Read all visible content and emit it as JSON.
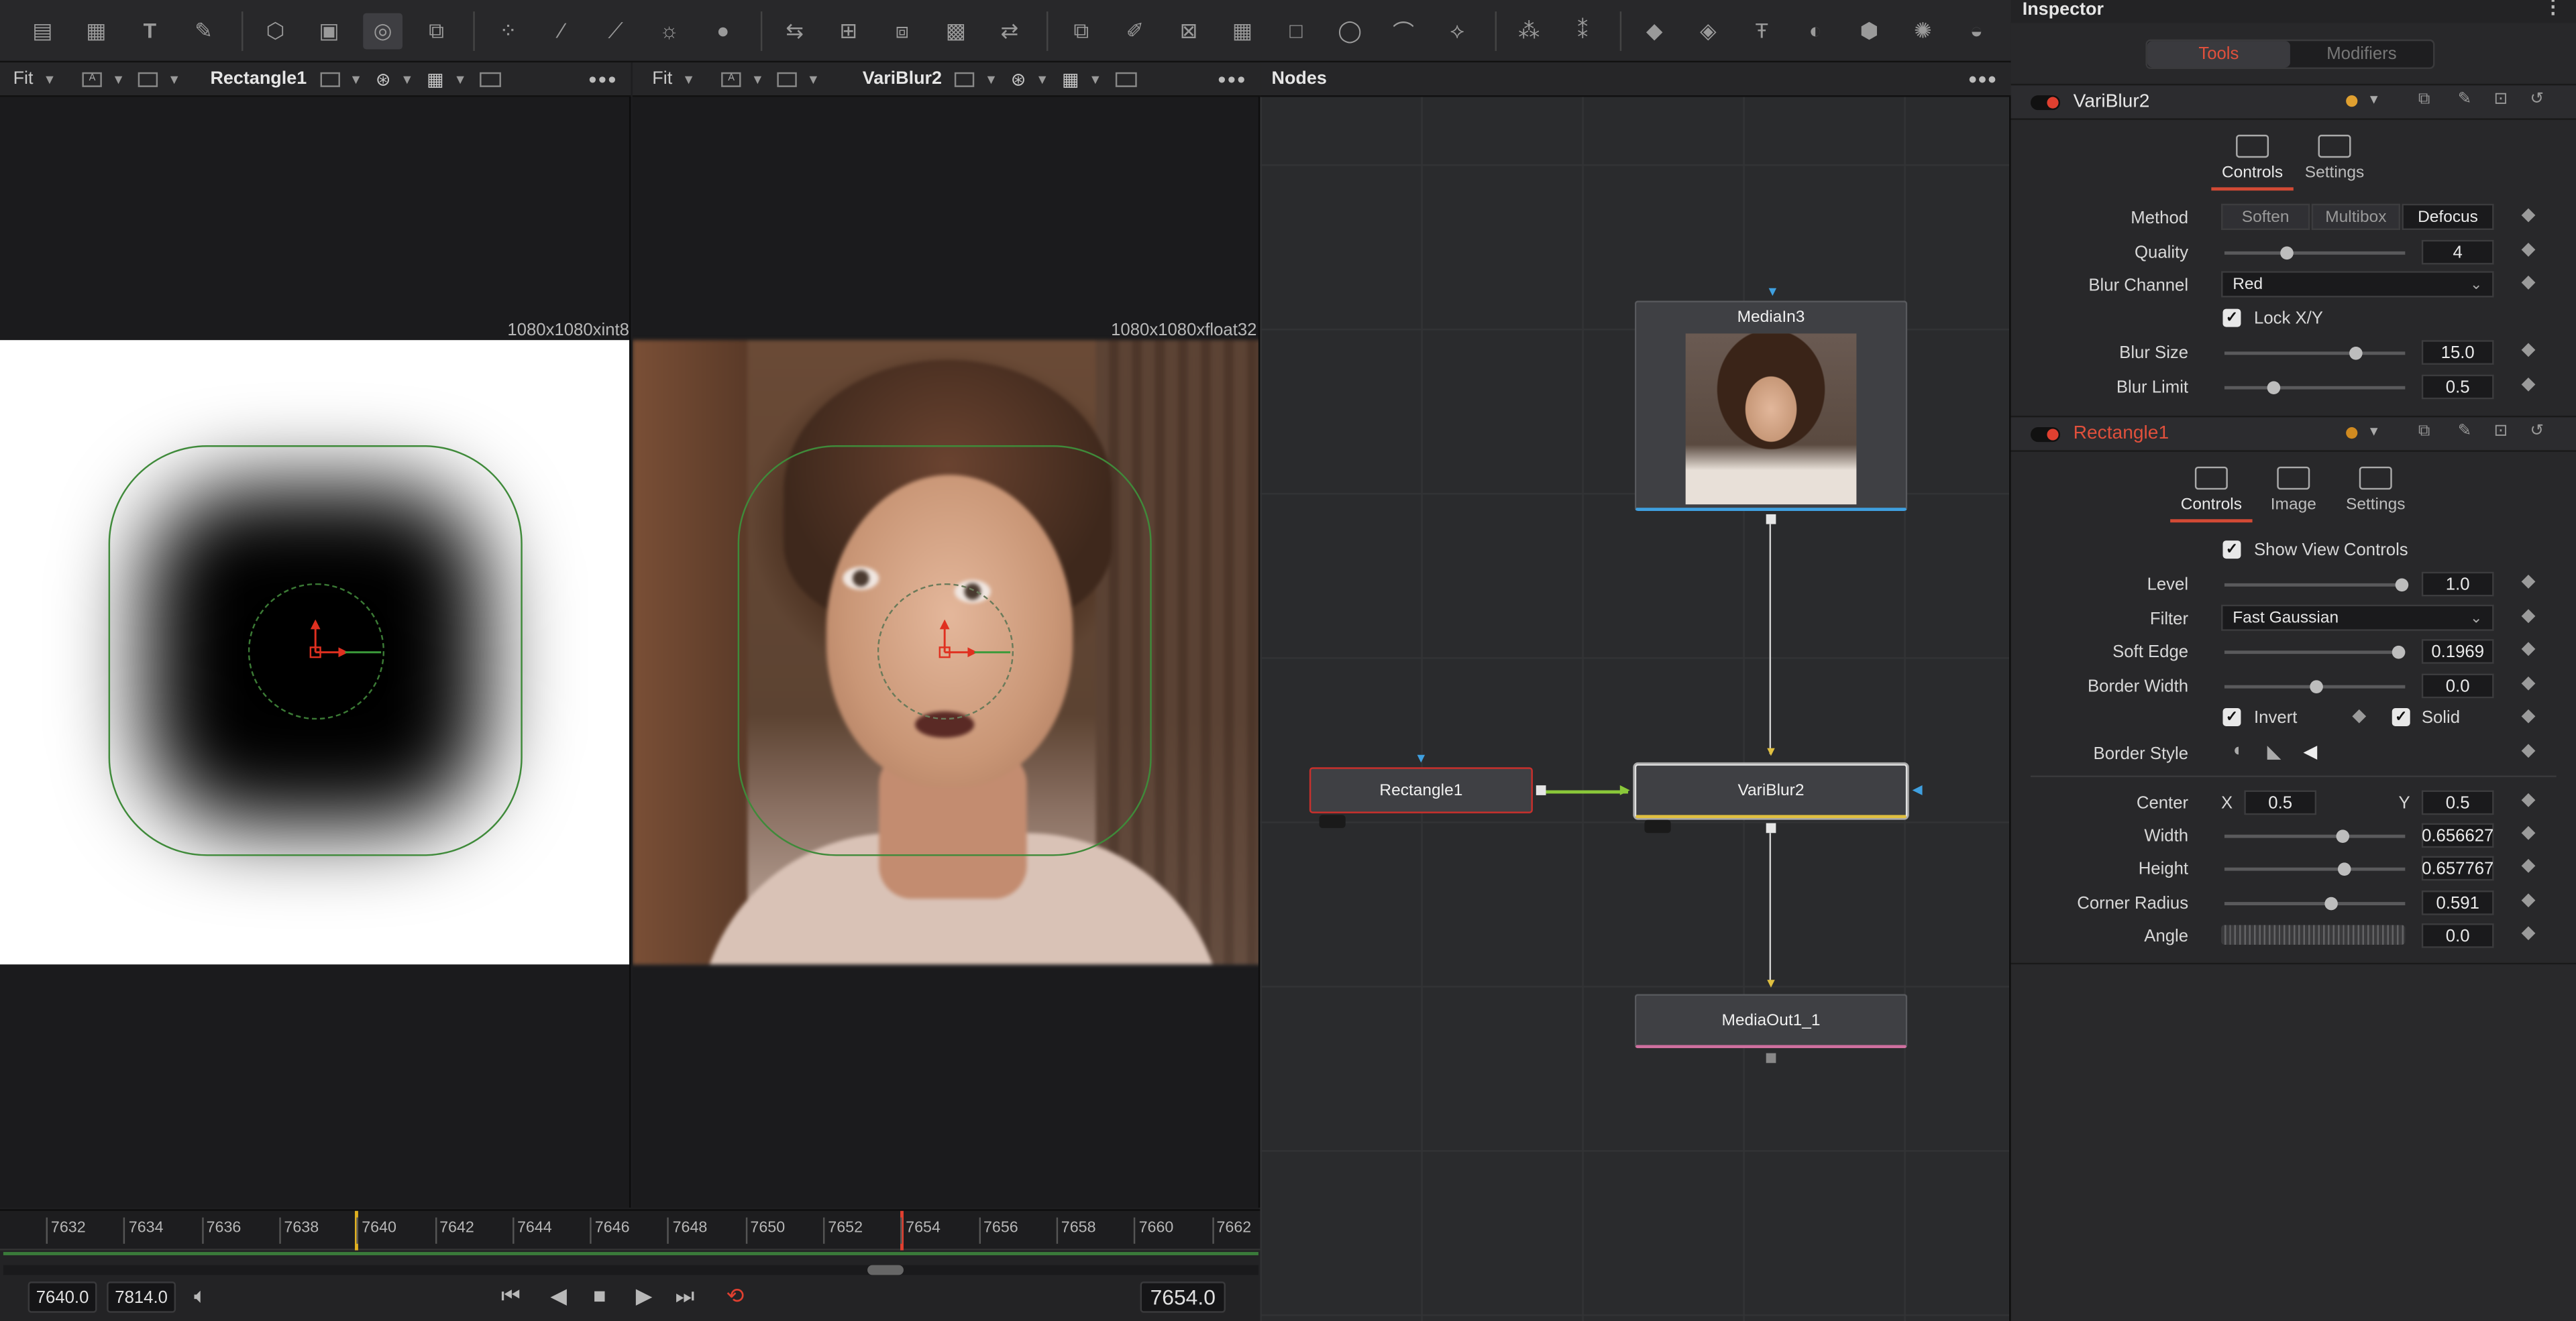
{
  "toolbar": {
    "icons": [
      "background-icon",
      "fastnoise-icon",
      "text-icon",
      "paint-icon",
      "polygon-icon",
      "rectangle-tool-icon",
      "ellipse-tool-icon",
      "3d-icon",
      "particles-icon",
      "curves-icon",
      "gamut-icon",
      "brightness-icon",
      "colorcorrect-icon",
      "merge-icon",
      "transform-icon",
      "resize-icon",
      "crop-icon",
      "blur-icon",
      "warp-icon",
      "mask-icon",
      "tracker-icon",
      "planar-icon",
      "shape3d-icon",
      "camera3d-icon",
      "text3d-icon",
      "light3d-icon",
      "render3d-icon",
      "spot-icon",
      "globe-icon"
    ]
  },
  "viewer_left": {
    "fit": "Fit",
    "name": "Rectangle1",
    "resolution": "1080x1080xint8"
  },
  "viewer_right": {
    "fit": "Fit",
    "name": "VariBlur2",
    "resolution": "1080x1080xfloat32"
  },
  "nodes": {
    "title": "Nodes",
    "items": [
      {
        "label": "MediaIn3"
      },
      {
        "label": "Rectangle1"
      },
      {
        "label": "VariBlur2"
      },
      {
        "label": "MediaOut1_1"
      }
    ]
  },
  "timeline": {
    "ticks": [
      "7632",
      "7634",
      "7636",
      "7638",
      "7640",
      "7642",
      "7644",
      "7646",
      "7648",
      "7650",
      "7652",
      "7654",
      "7656",
      "7658",
      "7660",
      "7662"
    ],
    "start": "7640.0",
    "end": "7814.0",
    "current": "7654.0"
  },
  "inspector": {
    "title": "Inspector",
    "tabs": {
      "tools": "Tools",
      "modifiers": "Modifiers"
    },
    "variblur": {
      "name": "VariBlur2",
      "tab_controls": "Controls",
      "tab_settings": "Settings",
      "method_label": "Method",
      "methods": [
        "Soften",
        "Multibox",
        "Defocus"
      ],
      "quality_label": "Quality",
      "quality_value": "4",
      "quality_fraction": 0.3,
      "blur_channel_label": "Blur Channel",
      "blur_channel_value": "Red",
      "lock_label": "Lock X/Y",
      "blur_size_label": "Blur Size",
      "blur_size_value": "15.0",
      "blur_limit_label": "Blur Limit",
      "blur_limit_value": "0.5"
    },
    "rectangle": {
      "name": "Rectangle1",
      "tab_controls": "Controls",
      "tab_image": "Image",
      "tab_settings": "Settings",
      "show_view_controls": "Show View Controls",
      "level_label": "Level",
      "level_value": "1.0",
      "filter_label": "Filter",
      "filter_value": "Fast Gaussian",
      "soft_edge_label": "Soft Edge",
      "soft_edge_value": "0.1969",
      "border_width_label": "Border Width",
      "border_width_value": "0.0",
      "invert_label": "Invert",
      "solid_label": "Solid",
      "border_style_label": "Border Style",
      "center_label": "Center",
      "center_x_label": "X",
      "center_x": "0.5",
      "center_y_label": "Y",
      "center_y": "0.5",
      "width_label": "Width",
      "width_value": "0.656627",
      "height_label": "Height",
      "height_value": "0.657767",
      "corner_radius_label": "Corner Radius",
      "corner_radius_value": "0.591",
      "angle_label": "Angle",
      "angle_value": "0.0"
    },
    "colors": {
      "accent": "#d24a35",
      "status_dot_yellow": "#e0a030"
    }
  }
}
